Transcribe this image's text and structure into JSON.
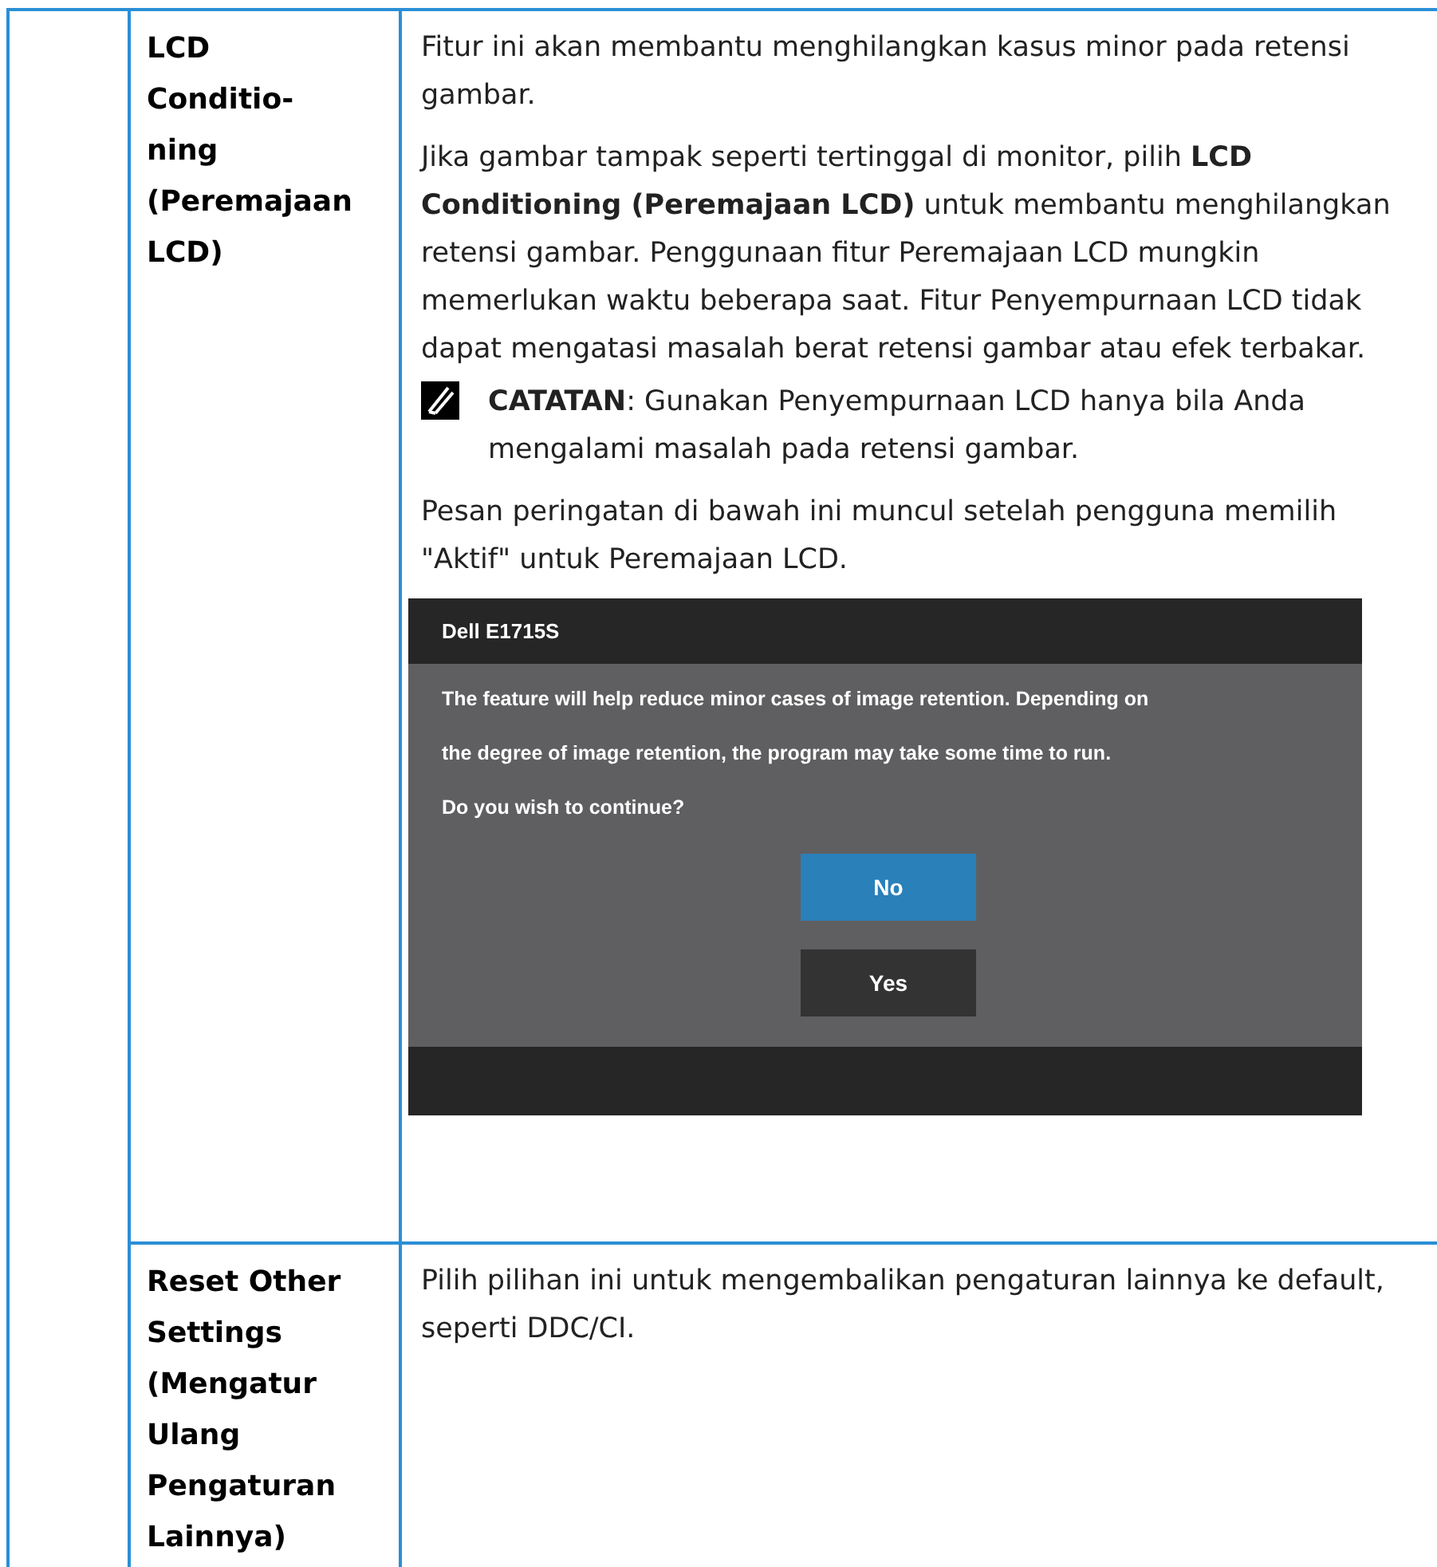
{
  "rows": [
    {
      "label_lines": [
        "LCD",
        "Conditio-",
        "ning",
        "(Peremajaan",
        "LCD)"
      ],
      "content": [
        {
          "kind": "paragraph",
          "text": "Fitur ini akan membantu menghilangkan kasus minor pada retensi gambar."
        },
        {
          "kind": "paragraph",
          "text": "Jika gambar tampak seperti tertinggal di monitor, pilih **LCD Conditioning (Peremajaan LCD)** untuk membantu menghilangkan retensi gambar. Penggunaan fitur Peremajaan LCD mungkin memerlukan waktu beberapa saat. Fitur Penyempurnaan LCD tidak dapat mengatasi masalah berat retensi gambar atau efek terbakar."
        },
        {
          "kind": "note",
          "text": "**CATATAN**: Gunakan Penyempurnaan LCD hanya bila Anda mengalami masalah pada retensi gambar."
        },
        {
          "kind": "paragraph",
          "text": "Pesan peringatan di bawah ini muncul setelah pengguna memilih \"Aktif\" untuk Peremajaan LCD."
        },
        {
          "kind": "dialog",
          "title": "Dell E1715S",
          "messages": [
            "The feature will help reduce minor cases of image retention. Depending on",
            "the degree of image retention, the program may take some time to run.",
            "Do you wish to continue?"
          ],
          "buttons": [
            {
              "label": "No",
              "selected": true
            },
            {
              "label": "Yes",
              "selected": false
            }
          ]
        }
      ]
    },
    {
      "label_lines": [
        "Reset Other",
        "Settings",
        "(Mengatur",
        "Ulang",
        "Pengaturan",
        "Lainnya)"
      ],
      "content": [
        {
          "kind": "paragraph",
          "text": "Pilih pilihan ini untuk mengembalikan pengaturan lainnya ke default, seperti DDC/CI."
        }
      ]
    }
  ]
}
